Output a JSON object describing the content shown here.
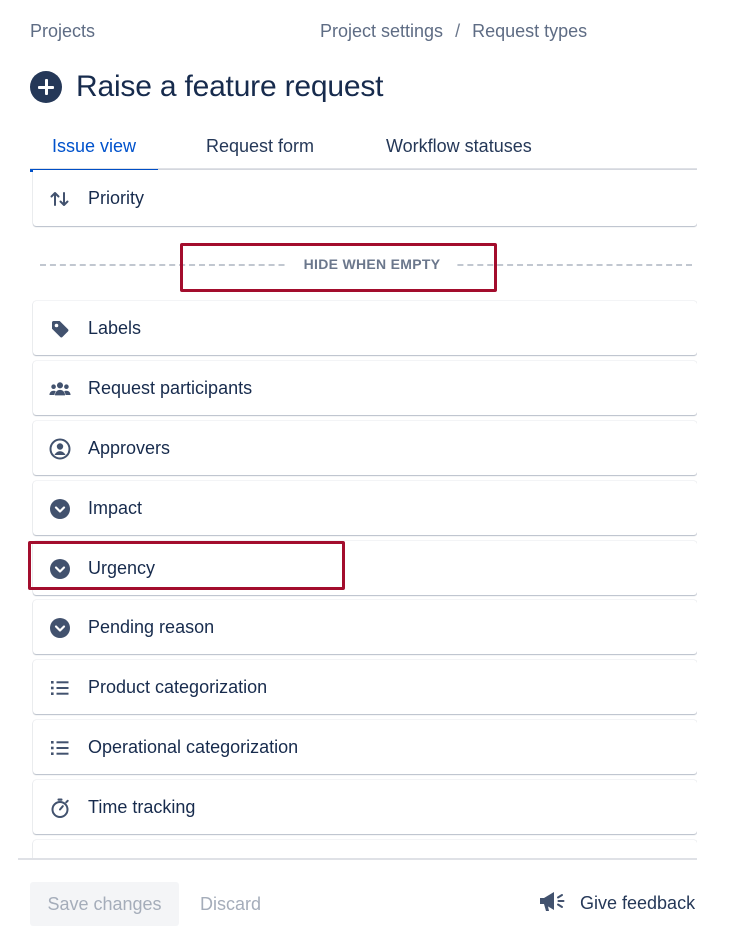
{
  "breadcrumb": {
    "projects": "Projects",
    "project_settings": "Project settings",
    "separator": "/",
    "request_types": "Request types"
  },
  "header": {
    "title": "Raise a feature request",
    "title_icon": "add-circle-icon"
  },
  "tabs": [
    {
      "label": "Issue view",
      "active": true
    },
    {
      "label": "Request form",
      "active": false
    },
    {
      "label": "Workflow statuses",
      "active": false
    }
  ],
  "fields_top": [
    {
      "label": "Priority",
      "icon": "priority-sort-icon"
    }
  ],
  "hide_when_empty_label": "HIDE WHEN EMPTY",
  "fields": [
    {
      "label": "Labels",
      "icon": "tag-icon"
    },
    {
      "label": "Request participants",
      "icon": "people-group-icon"
    },
    {
      "label": "Approvers",
      "icon": "person-circle-icon"
    },
    {
      "label": "Impact",
      "icon": "chevron-circle-icon"
    },
    {
      "label": "Urgency",
      "icon": "chevron-circle-icon"
    },
    {
      "label": "Pending reason",
      "icon": "chevron-circle-icon"
    },
    {
      "label": "Product categorization",
      "icon": "list-icon"
    },
    {
      "label": "Operational categorization",
      "icon": "list-icon"
    },
    {
      "label": "Time tracking",
      "icon": "stopwatch-icon"
    }
  ],
  "footer": {
    "save_label": "Save changes",
    "discard_label": "Discard",
    "feedback_label": "Give feedback",
    "feedback_icon": "megaphone-icon"
  },
  "colors": {
    "accent": "#0052cc",
    "text": "#172b4d",
    "subtle": "#5e6c84",
    "icon": "#42526e",
    "highlight": "#a30d2d"
  }
}
